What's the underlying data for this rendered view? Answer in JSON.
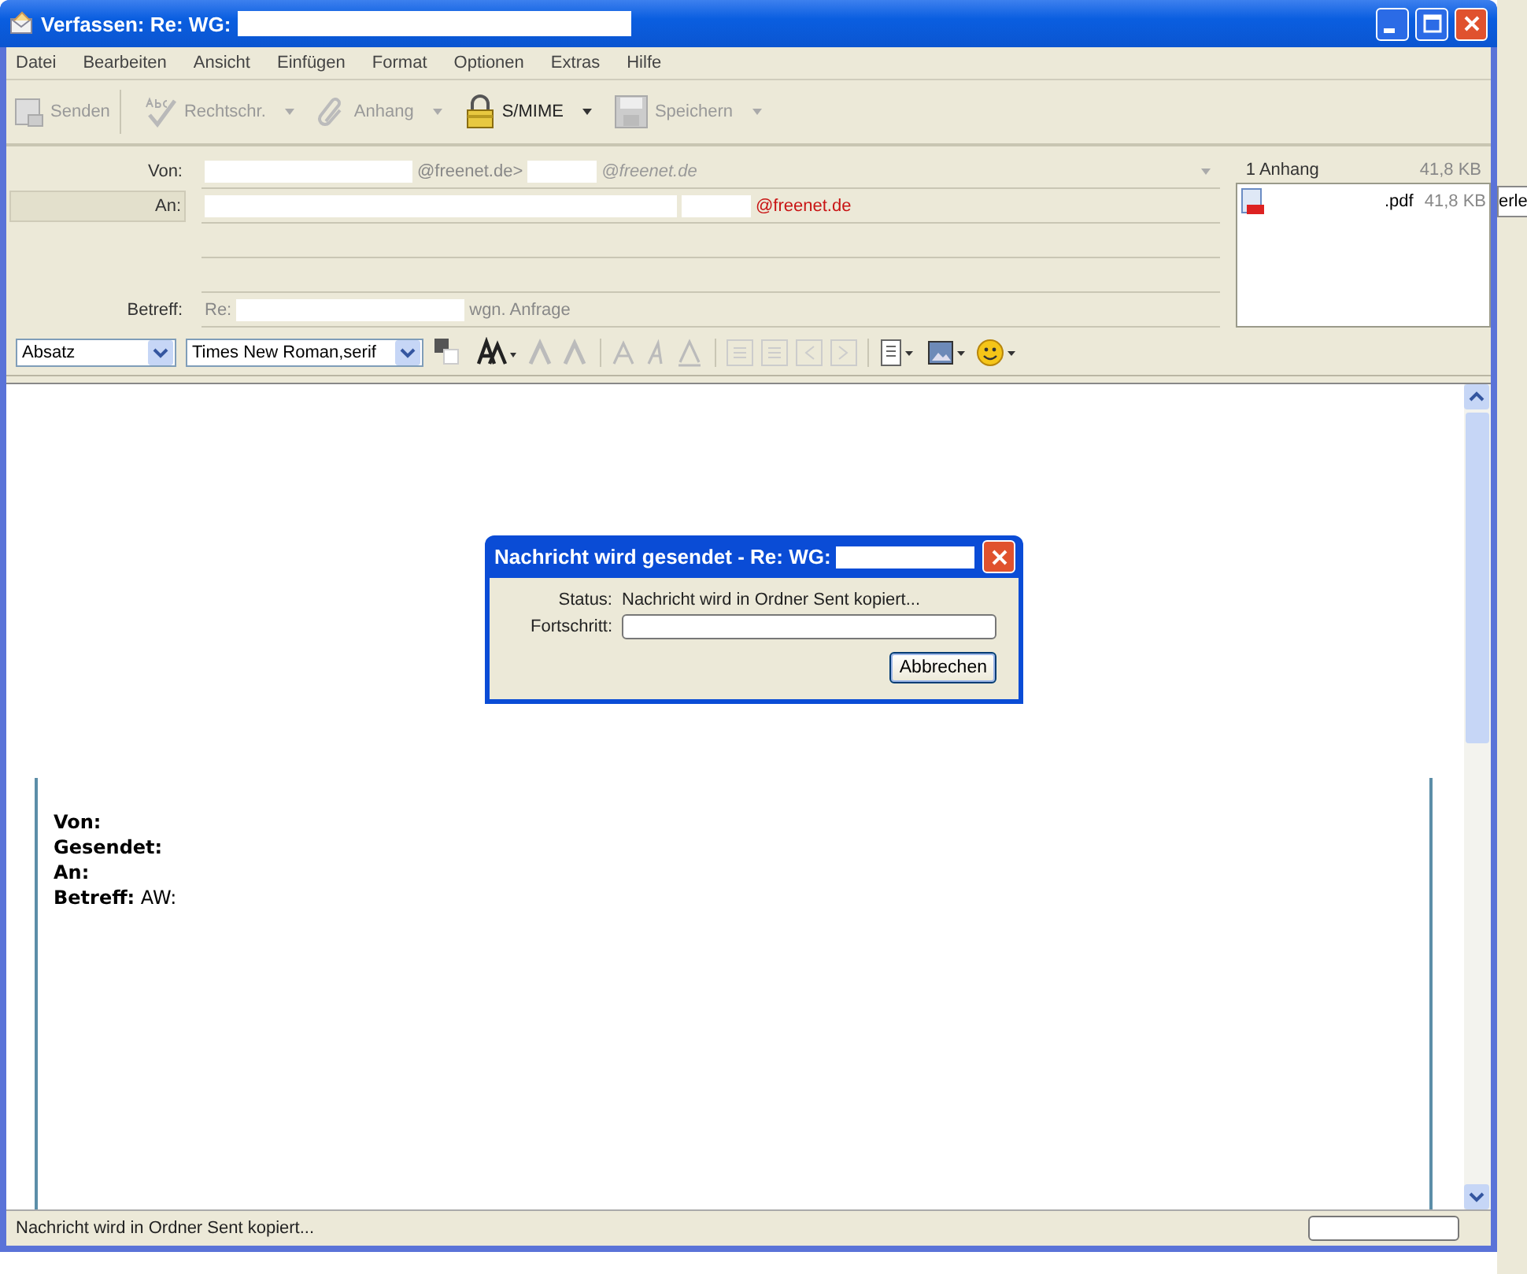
{
  "window": {
    "title": "Verfassen: Re: WG:"
  },
  "menu": [
    {
      "label": "Datei"
    },
    {
      "label": "Bearbeiten"
    },
    {
      "label": "Ansicht"
    },
    {
      "label": "Einfügen"
    },
    {
      "label": "Format"
    },
    {
      "label": "Optionen"
    },
    {
      "label": "Extras"
    },
    {
      "label": "Hilfe"
    }
  ],
  "toolbar": [
    {
      "kind": "send",
      "label": "Senden",
      "disabled": true,
      "dropdown": false
    },
    {
      "kind": "spell",
      "label": "Rechtschr.",
      "disabled": true,
      "dropdown": true
    },
    {
      "kind": "attach",
      "label": "Anhang",
      "disabled": true,
      "dropdown": true
    },
    {
      "kind": "lock",
      "label": "S/MIME",
      "disabled": false,
      "dropdown": true
    },
    {
      "kind": "save",
      "label": "Speichern",
      "disabled": true,
      "dropdown": true
    }
  ],
  "headers": [
    {
      "kind": "from",
      "label": "Von:",
      "parts": [
        {
          "kind": "address",
          "text": "@freenet.de>",
          "masked_before": true
        },
        {
          "kind": "alias",
          "text": "@freenet.de",
          "masked_before": true
        }
      ]
    },
    {
      "kind": "to",
      "label": "An:",
      "parts": [
        {
          "kind": "recipient",
          "text": "@freenet.de",
          "masked_before": true
        }
      ]
    },
    {
      "kind": "blank"
    },
    {
      "kind": "blank"
    },
    {
      "kind": "subject",
      "label": "Betreff:",
      "parts": [
        {
          "kind": "address",
          "text": "Re:",
          "masked_before": false
        },
        {
          "kind": "address",
          "text": "wgn. Anfrage",
          "masked_before": true
        }
      ]
    }
  ],
  "attachments": {
    "title": "1 Anhang",
    "total": "41,8 KB",
    "items": [
      {
        "name": ".pdf",
        "size": "41,8 KB"
      }
    ]
  },
  "format_bar": {
    "paragraph": "Absatz",
    "font": "Times New Roman,serif"
  },
  "body": {
    "quote": [
      {
        "label": "Von:"
      },
      {
        "label": "Gesendet:"
      },
      {
        "label": "An:"
      },
      {
        "label": "Betreff:",
        "value": "AW:"
      }
    ]
  },
  "dialog": {
    "title": "Nachricht wird gesendet - Re: WG:",
    "status_label": "Status:",
    "status": "Nachricht wird in Ordner Sent kopiert...",
    "progress_label": "Fortschritt:",
    "level": 0,
    "button": "Abbrechen"
  },
  "status_bar": {
    "text": "Nachricht wird in Ordner Sent kopiert...",
    "level": 0
  },
  "background_window": {
    "text": "erle"
  }
}
